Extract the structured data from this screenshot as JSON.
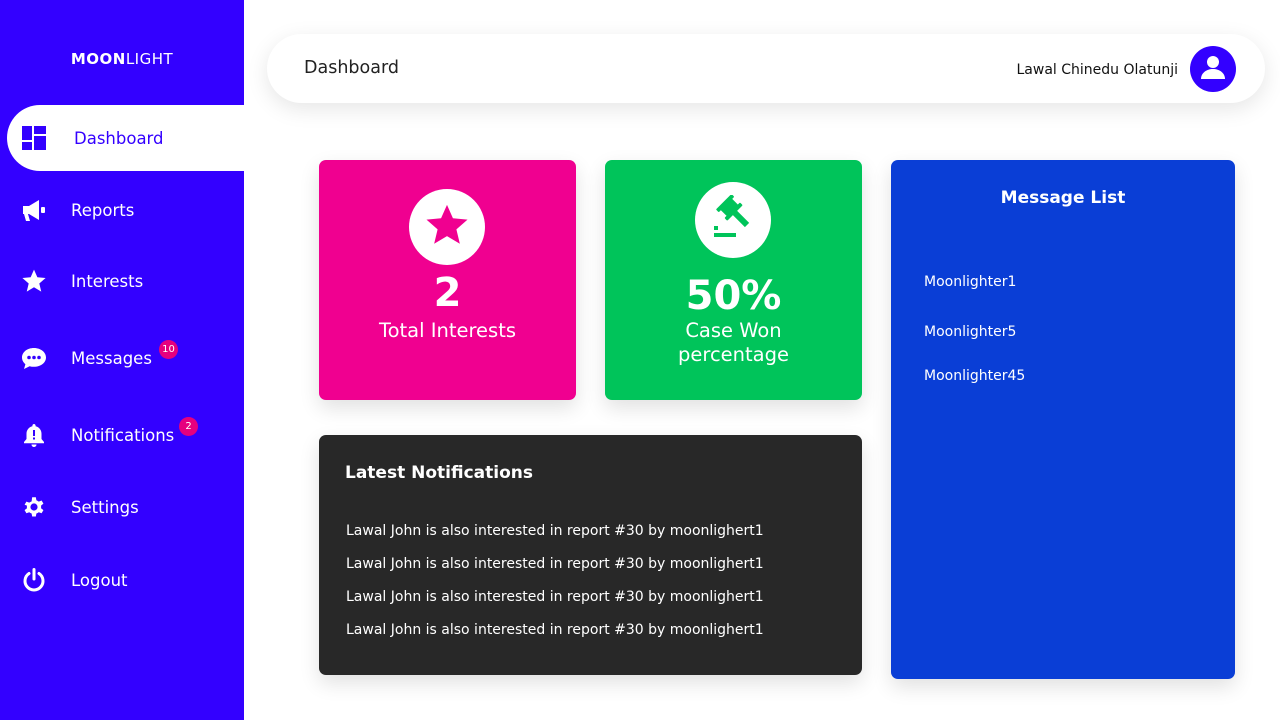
{
  "brand": {
    "logo_bold": "MOON",
    "logo_light": "LIGHT"
  },
  "sidebar": {
    "items": [
      {
        "label": "Dashboard",
        "icon": "dashboard-icon",
        "active": true
      },
      {
        "label": "Reports",
        "icon": "megaphone-icon"
      },
      {
        "label": "Interests",
        "icon": "star-icon"
      },
      {
        "label": "Messages",
        "icon": "chat-bubble-icon",
        "badge": "10"
      },
      {
        "label": "Notifications",
        "icon": "bell-icon",
        "badge": "2"
      },
      {
        "label": "Settings",
        "icon": "gear-icon"
      },
      {
        "label": "Logout",
        "icon": "power-icon"
      }
    ]
  },
  "header": {
    "title": "Dashboard",
    "user_name": "Lawal Chinedu Olatunji",
    "avatar_icon": "user-icon"
  },
  "stats": {
    "interests": {
      "value": "2",
      "label": "Total Interests",
      "icon": "star-icon",
      "color": "#f00090"
    },
    "cases": {
      "value": "50%",
      "label_line1": "Case Won",
      "label_line2": "percentage",
      "icon": "gavel-icon",
      "color": "#00c45a"
    }
  },
  "notifications": {
    "title": "Latest Notifications",
    "items": [
      "Lawal John is also interested in report #30 by moonlighert1",
      "Lawal John is also interested in report #30 by moonlighert1",
      "Lawal John is also interested in report #30 by moonlighert1",
      "Lawal John is also interested in report #30 by moonlighert1"
    ]
  },
  "messages": {
    "title": "Message List",
    "items": [
      "Moonlighter1",
      "Moonlighter5",
      "Moonlighter45"
    ]
  },
  "colors": {
    "sidebar": "#3300ff",
    "message_panel": "#0a3ed6",
    "notification_panel": "#282828",
    "badge": "#e6007e"
  }
}
